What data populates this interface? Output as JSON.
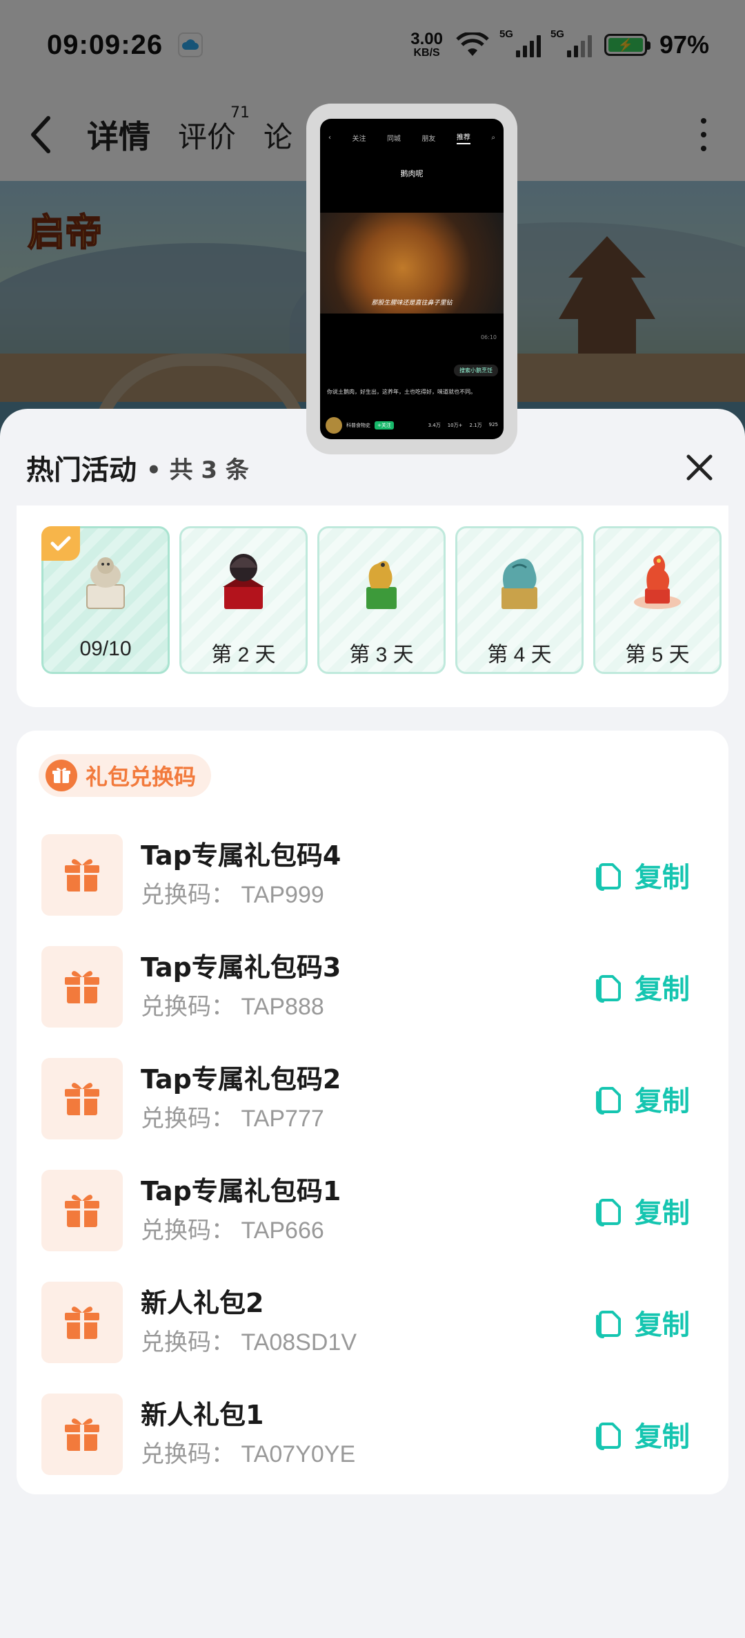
{
  "status_bar": {
    "time": "09:09:26",
    "net_speed_value": "3.00",
    "net_speed_unit": "KB/S",
    "sim1": "5G",
    "sim2": "5G",
    "battery": "97%",
    "battery_level": 0.97
  },
  "nav": {
    "tabs": [
      {
        "label": "详情",
        "active": true
      },
      {
        "label": "评价",
        "badge": "71"
      },
      {
        "label": "论"
      }
    ]
  },
  "banner": {
    "logo_text": "启帝"
  },
  "pip": {
    "tabs": [
      "关注",
      "同城",
      "朋友",
      "推荐"
    ],
    "title": "鹅肉呢",
    "caption": "那股生腥味还是直往鼻子里钻",
    "meta_time": "06:10",
    "search": "搜索小鹅烹饪",
    "desc": "你说土鹅肉，好生出，这养年，土也吃得好，味道就也不同。",
    "author": "科普食物史",
    "follow": "+关注",
    "stats": [
      "3.4万",
      "10万+",
      "2.1万",
      "925"
    ]
  },
  "sheet": {
    "title": "热门活动",
    "count": "• 共 3 条"
  },
  "days": [
    {
      "label": "09/10",
      "checked": true
    },
    {
      "label": "第 2 天",
      "checked": false
    },
    {
      "label": "第 3 天",
      "checked": false
    },
    {
      "label": "第 4 天",
      "checked": false
    },
    {
      "label": "第 5 天",
      "checked": false
    }
  ],
  "gift_section": {
    "title": "礼包兑换码",
    "copy_label": "复制",
    "code_prefix": "兑换码：",
    "items": [
      {
        "name": "Tap专属礼包码4",
        "code": "兑换码：  TAP999"
      },
      {
        "name": "Tap专属礼包码3",
        "code": "兑换码：  TAP888"
      },
      {
        "name": "Tap专属礼包码2",
        "code": "兑换码：  TAP777"
      },
      {
        "name": "Tap专属礼包码1",
        "code": "兑换码：  TAP666"
      },
      {
        "name": "新人礼包2",
        "code": "兑换码：  TA08SD1V"
      },
      {
        "name": "新人礼包1",
        "code": "兑换码：  TA07Y0YE"
      }
    ]
  },
  "colors": {
    "accent": "#15c5b0",
    "gift_orange": "#f27a3c",
    "gift_bg": "#fdeee6",
    "check_badge": "#f7b54a"
  }
}
